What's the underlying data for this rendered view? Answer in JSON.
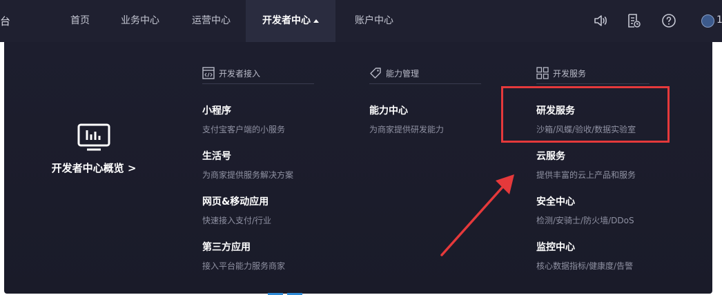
{
  "header": {
    "brand_fragment": "台",
    "nav": [
      {
        "label": "首页"
      },
      {
        "label": "业务中心"
      },
      {
        "label": "运营中心"
      },
      {
        "label": "开发者中心"
      },
      {
        "label": "账户中心"
      }
    ],
    "active_nav": "开发者中心",
    "icons": [
      "speaker-icon",
      "document-clock-icon",
      "help-icon"
    ],
    "user_fragment": "1"
  },
  "dropdown": {
    "overview_label": "开发者中心概览 >",
    "columns": [
      {
        "heading": "开发者接入",
        "icon": "code-window-icon",
        "items": [
          {
            "title": "小程序",
            "desc": "支付宝客户端的小服务"
          },
          {
            "title": "生活号",
            "desc": "为商家提供服务解决方案"
          },
          {
            "title": "网页&移动应用",
            "desc": "快速接入支付/行业"
          },
          {
            "title": "第三方应用",
            "desc": "接入平台能力服务商家"
          }
        ]
      },
      {
        "heading": "能力管理",
        "icon": "tag-icon",
        "items": [
          {
            "title": "能力中心",
            "desc": "为商家提供研发能力"
          }
        ]
      },
      {
        "heading": "开发服务",
        "icon": "grid-icon",
        "items": [
          {
            "title": "研发服务",
            "desc": "沙箱/风蝶/验收/数据实验室"
          },
          {
            "title": "云服务",
            "desc": "提供丰富的云上产品和服务"
          },
          {
            "title": "安全中心",
            "desc": "检测/安骑士/防火墙/DDoS"
          },
          {
            "title": "监控中心",
            "desc": "核心数据指标/健康度/告警"
          }
        ]
      }
    ]
  },
  "annotation": {
    "highlight_color": "#e5393b",
    "highlighted_item": "研发服务"
  }
}
